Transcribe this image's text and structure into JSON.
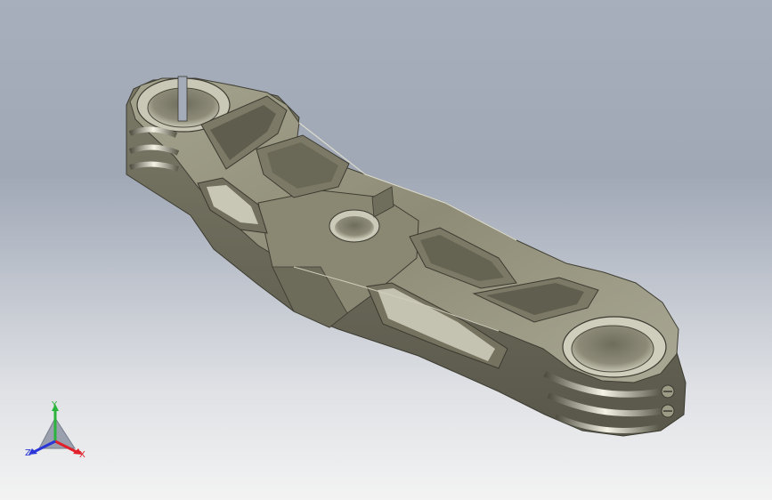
{
  "viewport": {
    "background_top": "#a2a9b7",
    "background_bottom": "#f2f2f2",
    "model": "triple-clamp-part"
  },
  "part": {
    "body_color": "#8f8d77",
    "shade_color": "#5c5a4b",
    "highlight_color": "#d9d8c8"
  },
  "triad": {
    "x_label": "X",
    "y_label": "Y",
    "z_label": "Z",
    "x_color": "#e0202a",
    "y_color": "#2bb43c",
    "z_color": "#2a36d8"
  }
}
